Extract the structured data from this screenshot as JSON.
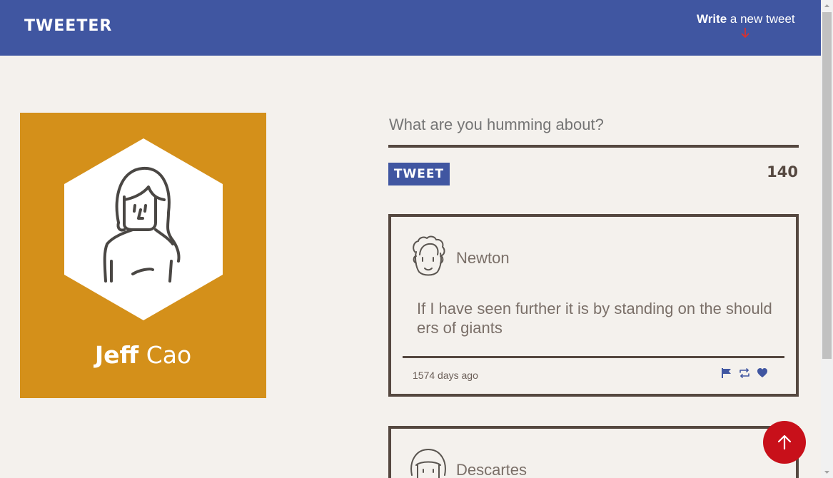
{
  "navbar": {
    "logo": "TWEETER",
    "write_bold": "Write",
    "write_rest": " a new tweet"
  },
  "profile": {
    "first_name": "Jeff",
    "last_name": "Cao"
  },
  "composer": {
    "placeholder": "What are you humming about?",
    "button_label": "TWEET",
    "counter": "140"
  },
  "tweets": [
    {
      "author": "Newton",
      "text": "If I have seen further it is by standing on the should ers of giants",
      "time": "1574 days ago"
    },
    {
      "author": "Descartes"
    }
  ],
  "colors": {
    "nav": "#4056a1",
    "card": "#d4901a",
    "accent_red": "#c8101a",
    "text_dark": "#554840"
  },
  "icons": {
    "write_arrow": "arrow-down-icon",
    "flag": "flag-icon",
    "retweet": "retweet-icon",
    "like": "heart-icon",
    "scroll_top": "arrow-up-icon"
  }
}
